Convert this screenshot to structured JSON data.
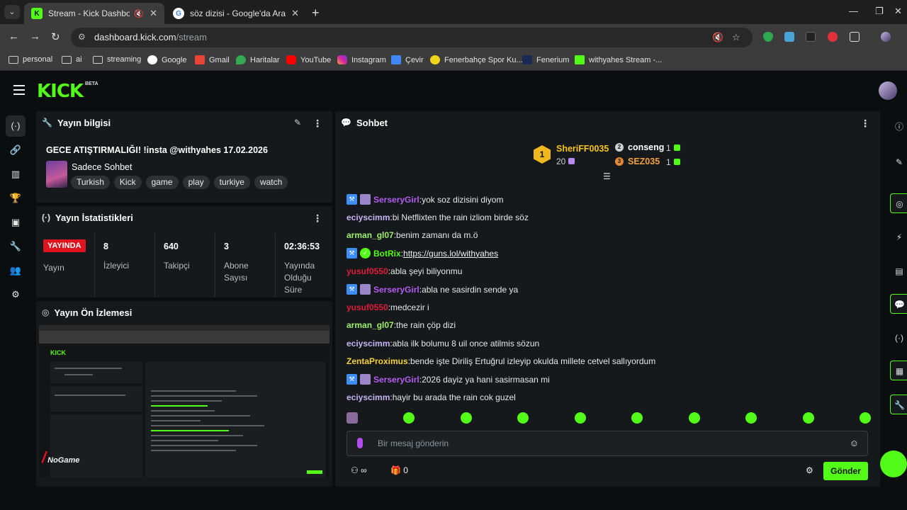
{
  "browser": {
    "tabs": [
      {
        "title": "Stream - Kick Dashboard",
        "active": true
      },
      {
        "title": "söz dizisi - Google'da Ara",
        "active": false
      }
    ],
    "url_host": "dashboard.kick.com",
    "url_path": "/stream",
    "bookmarks": [
      "personal",
      "ai",
      "streaming",
      "Google",
      "Gmail",
      "Haritalar",
      "YouTube",
      "Instagram",
      "Çevir",
      "Fenerbahçe Spor Ku...",
      "Fenerium",
      "withyahes Stream -..."
    ]
  },
  "kick": {
    "logo": "KICK",
    "beta": "BETA"
  },
  "info_panel": {
    "title": "Yayın bilgisi",
    "stream_title": "GECE ATIŞTIRMALIĞI! !insta @withyahes 17.02.2026",
    "category": "Sadece Sohbet",
    "tags": [
      "Turkish",
      "Kick",
      "game",
      "play",
      "turkiye",
      "watch"
    ]
  },
  "stats_panel": {
    "title": "Yayın İstatistikleri",
    "live_badge": "YAYINDA",
    "live_label": "Yayın",
    "stats": [
      {
        "value": "8",
        "label": "İzleyici"
      },
      {
        "value": "640",
        "label": "Takipçi"
      },
      {
        "value": "3",
        "label": "Abone Sayısı"
      },
      {
        "value": "02:36:53",
        "label": "Yayında Olduğu Süre"
      }
    ]
  },
  "preview_panel": {
    "title": "Yayın Ön İzlemesi",
    "watermark": "NoGame"
  },
  "chat": {
    "title": "Sohbet",
    "leaderboard": {
      "first": {
        "rank": "1",
        "name": "SheriFF0035",
        "count": "20"
      },
      "second": {
        "name": "conseng",
        "count": "1"
      },
      "third": {
        "name": "SEZ035",
        "count": "1"
      }
    },
    "messages": [
      {
        "user": "SerseryGirl",
        "color": "#b45cf2",
        "badges": true,
        "text": "yok soz dizisini diyom"
      },
      {
        "user": "eciyscimm",
        "color": "#c7b3f5",
        "badges": false,
        "text": "bi Netflixten the rain izliom birde söz"
      },
      {
        "user": "arman_gl07",
        "color": "#9cf06a",
        "badges": false,
        "text": "benim zamanı da m.ö"
      },
      {
        "user": "BotRix",
        "color": "#53fc18",
        "badges": true,
        "text": "https://guns.lol/withyahes",
        "link": true
      },
      {
        "user": "yusuf0550",
        "color": "#e01b3b",
        "badges": false,
        "text": "abla şeyi biliyonmu"
      },
      {
        "user": "SerseryGirl",
        "color": "#b45cf2",
        "badges": true,
        "text": "abla ne sasirdin sende ya"
      },
      {
        "user": "yusuf0550",
        "color": "#e01b3b",
        "badges": false,
        "text": "medcezir i"
      },
      {
        "user": "arman_gl07",
        "color": "#9cf06a",
        "badges": false,
        "text": "the rain çöp dizi"
      },
      {
        "user": "eciyscimm",
        "color": "#c7b3f5",
        "badges": false,
        "text": "abla ilk bolumu 8 uil once atilmis sözun"
      },
      {
        "user": "ZentaProximus",
        "color": "#f5d13b",
        "badges": false,
        "text": "bende işte Diriliş Ertuğrul izleyip okulda millete cetvel sallıyordum"
      },
      {
        "user": "SerseryGirl",
        "color": "#b45cf2",
        "badges": true,
        "text": "2026 dayiz ya hani sasirmasan mi"
      },
      {
        "user": "eciyscimm",
        "color": "#c7b3f5",
        "badges": false,
        "text": "hayir bu arada the rain cok guzel"
      }
    ],
    "input_placeholder": "Bir mesaj gönderin",
    "points": "0",
    "send_label": "Gönder"
  }
}
